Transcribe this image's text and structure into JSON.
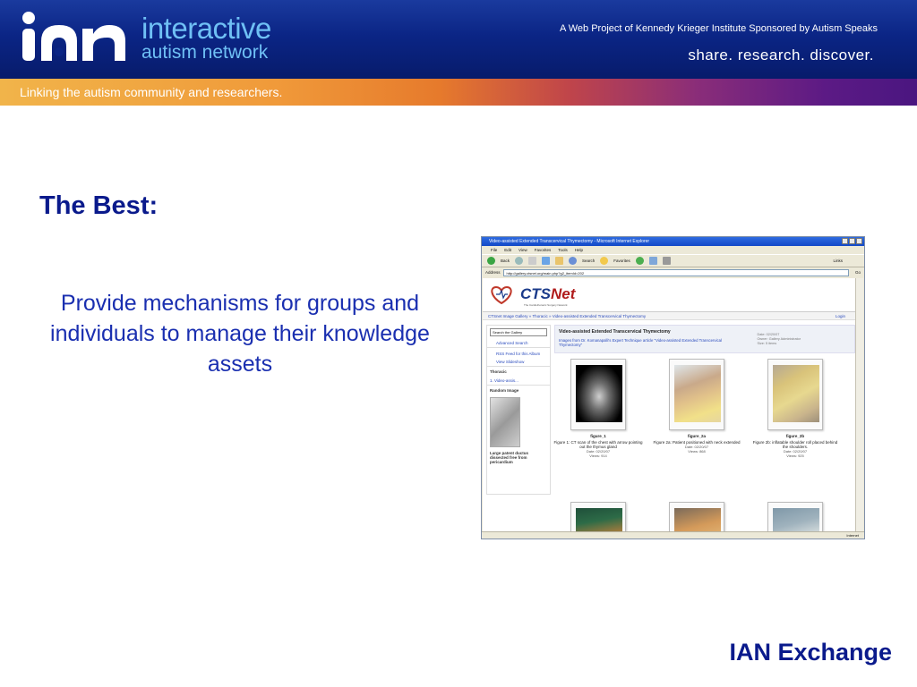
{
  "header": {
    "logo_text": "iAn",
    "brand_line1": "interactive",
    "brand_line2": "autism network",
    "web_project": "A Web Project of Kennedy Krieger Institute  Sponsored by Autism Speaks",
    "slogan": "share. research. discover."
  },
  "subbar": {
    "text": "Linking the autism community and researchers."
  },
  "slide": {
    "title": "The Best:",
    "body": "Provide mechanisms for groups and individuals to manage their knowledge assets",
    "footer": "IAN Exchange"
  },
  "browser": {
    "window_title": "Video-assisted Extended Transcervical Thymectomy - Microsoft Internet Explorer",
    "menu": [
      "File",
      "Edit",
      "View",
      "Favorites",
      "Tools",
      "Help"
    ],
    "toolbar": {
      "back": "Back",
      "search": "Search",
      "favorites": "Favorites",
      "links": "Links"
    },
    "address_label": "Address",
    "address_value": "http://gallery.ctsnet.org/main.php?g2_itemId=202",
    "go_label": "Go",
    "status_text": "Internet",
    "site": {
      "logo_main": "CTS",
      "logo_accent": "Net",
      "logo_sub": "The Cardiothoracic Surgery Network",
      "breadcrumb": "CTSnet Image Gallery  »  Thoracic  »  Video-assisted Extended Transcervical Thymectomy",
      "login": "Login",
      "search_placeholder": "Search the Gallery",
      "advanced_search": "Advanced Search",
      "rss": "RSS Feed for this Album",
      "slideshow": "View Slideshow",
      "section_thoracic": "Thoracic",
      "thoracic_link": "1. Video-assis...",
      "random_image": "Random Image",
      "random_caption": "Large patent ductus dissected free from pericardium",
      "album_title": "Video-assisted Extended Transcervical Thymectomy",
      "album_desc": "Images from Dr. Komanapalli's Expert Technique article \"Video-assisted Extended Transcervical Thymectomy\"",
      "album_meta": [
        "Date: 02/20/07",
        "Owner: Gallery Administrator",
        "Size: 5 items"
      ],
      "figures": [
        {
          "name": "figure_1",
          "caption": "Figure 1: CT scan of the chest with arrow pointing out the thymus gland",
          "date": "Date: 02/20/07",
          "views": "Views: 914"
        },
        {
          "name": "figure_2a",
          "caption": "Figure 2a: Patient positioned with neck extended",
          "date": "Date: 02/20/07",
          "views": "Views: 868"
        },
        {
          "name": "figure_2b",
          "caption": "Figure 2b: inflatable shoulder roll placed behind the shoulders.",
          "date": "Date: 02/20/07",
          "views": "Views: 925"
        }
      ]
    }
  }
}
